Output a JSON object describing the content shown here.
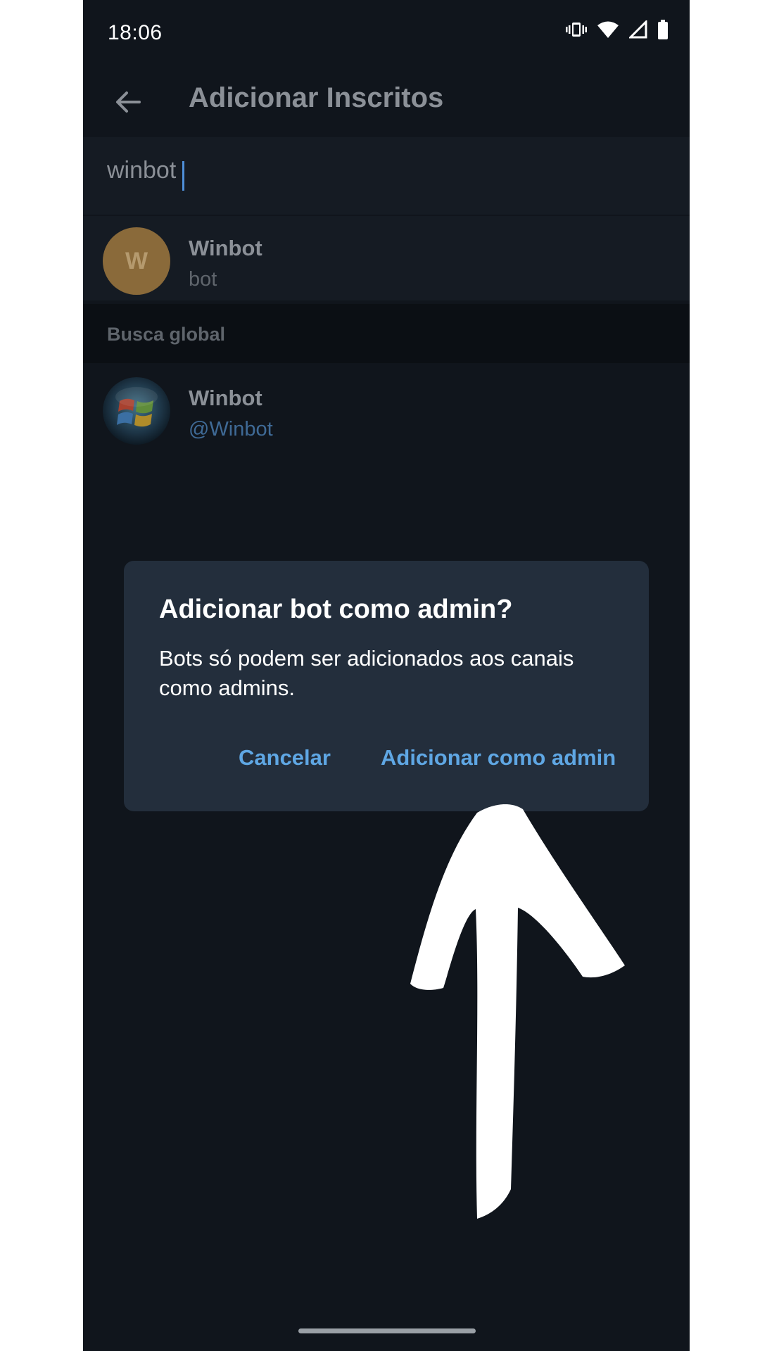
{
  "status_bar": {
    "time": "18:06",
    "icons": [
      "vibrate-icon",
      "wifi-icon",
      "signal-icon",
      "battery-icon"
    ]
  },
  "app_bar": {
    "title": "Adicionar Inscritos",
    "back_icon": "arrow-left-icon"
  },
  "search": {
    "value": "winbot"
  },
  "contacts": [
    {
      "avatar_letter": "W",
      "name": "Winbot",
      "subtitle": "bot"
    }
  ],
  "global_search": {
    "header": "Busca global",
    "results": [
      {
        "avatar_icon": "windows-logo-icon",
        "name": "Winbot",
        "username": "@Winbot"
      }
    ]
  },
  "dialog": {
    "title": "Adicionar bot como admin?",
    "message": "Bots só podem ser adicionados aos canais como admins.",
    "cancel_label": "Cancelar",
    "confirm_label": "Adicionar como admin"
  },
  "colors": {
    "background": "#10151c",
    "dialog": "#232e3c",
    "accent": "#5fa7e4",
    "avatar": "#8a6a3a"
  }
}
